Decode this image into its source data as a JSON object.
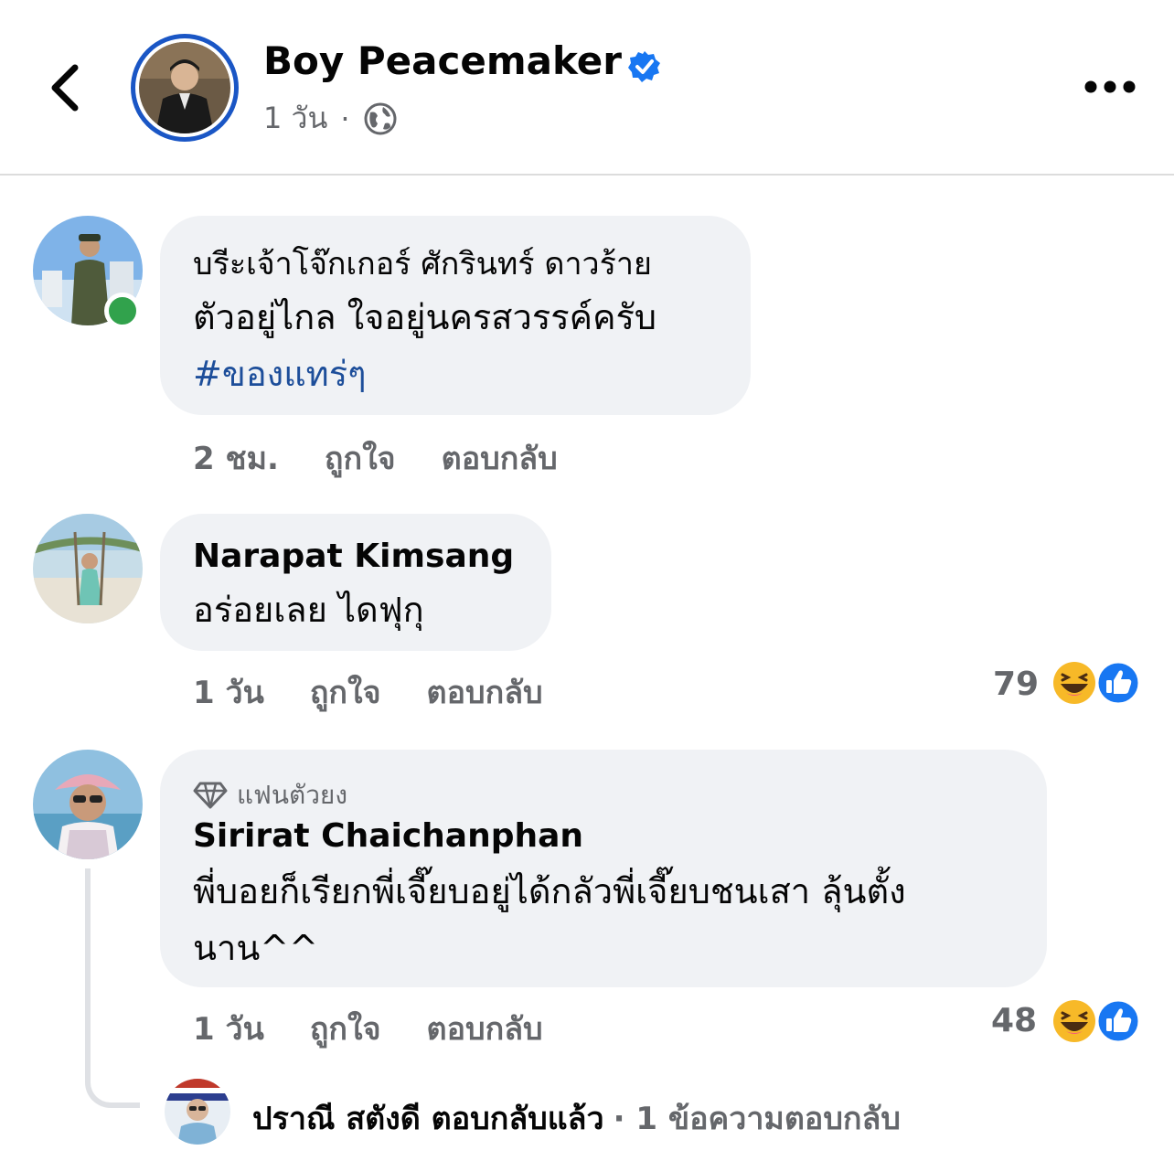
{
  "header": {
    "page_name": "Boy Peacemaker",
    "time": "1 วัน",
    "separator": "·",
    "icons": {
      "back": "chevron-left-icon",
      "verified": "verified-badge-icon",
      "privacy": "globe-icon",
      "more": "more-options-icon"
    }
  },
  "comments": [
    {
      "author_prefix": "บรีะเจ้าโจ๊กเกอร์ ศักรินทร์ ดาวร้าย",
      "text_line1": "ตัวอยู่ไกล ใจอยู่นครสวรรค์ครับ",
      "hashtag": "#ของแทร่ๆ",
      "time": "2 ชม.",
      "like_label": "ถูกใจ",
      "reply_label": "ตอบกลับ",
      "online": true
    },
    {
      "author": "Narapat Kimsang",
      "text": "อร่อยเลย ไดฟุกุ",
      "time": "1 วัน",
      "like_label": "ถูกใจ",
      "reply_label": "ตอบกลับ",
      "reaction_count": "79"
    },
    {
      "badge": "แฟนตัวยง",
      "author": "Sirirat Chaichanphan",
      "text_line1": "พี่บอยก็เรียกพี่เจี๊ยบอยู่ได้กลัวพี่เจี๊ยบชนเสา ลุ้นตั้ง",
      "text_line2": "นาน^^",
      "time": "1 วัน",
      "like_label": "ถูกใจ",
      "reply_label": "ตอบกลับ",
      "reaction_count": "48",
      "reply_summary": {
        "text": "ปราณี สตังดี ตอบกลับแล้ว",
        "count": "· 1 ข้อความตอบกลับ"
      }
    }
  ],
  "colors": {
    "accent": "#1877f2",
    "bubble": "#f0f2f5",
    "secondary_text": "#65676b",
    "hashtag": "#1d4e9a",
    "online": "#31a24c"
  }
}
